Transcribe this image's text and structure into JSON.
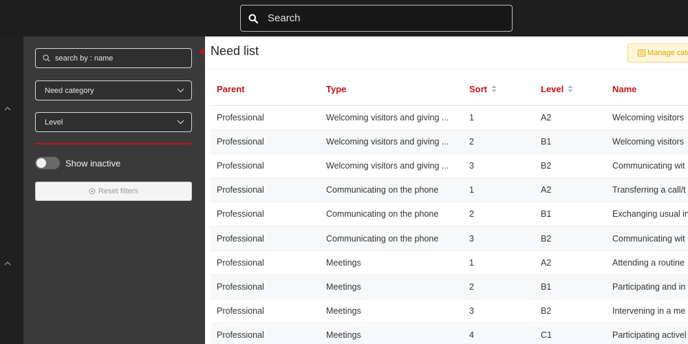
{
  "global_search": {
    "placeholder": "Search"
  },
  "filters": {
    "search_placeholder": "search by : name",
    "need_category": "Need category",
    "level": "Level",
    "show_inactive": "Show inactive",
    "reset_label": "Reset filters"
  },
  "main": {
    "title": "Need list",
    "manage_label": "Manage cate"
  },
  "table": {
    "headers": {
      "parent": "Parent",
      "type": "Type",
      "sort": "Sort",
      "level": "Level",
      "name": "Name"
    },
    "rows": [
      {
        "parent": "Professional",
        "type": "Welcoming visitors and giving ...",
        "sort": "1",
        "level": "A2",
        "name": "Welcoming visitors"
      },
      {
        "parent": "Professional",
        "type": "Welcoming visitors and giving ...",
        "sort": "2",
        "level": "B1",
        "name": "Welcoming visitors"
      },
      {
        "parent": "Professional",
        "type": "Welcoming visitors and giving ...",
        "sort": "3",
        "level": "B2",
        "name": "Communicating wit"
      },
      {
        "parent": "Professional",
        "type": "Communicating on the phone",
        "sort": "1",
        "level": "A2",
        "name": "Transferring a call/t"
      },
      {
        "parent": "Professional",
        "type": "Communicating on the phone",
        "sort": "2",
        "level": "B1",
        "name": "Exchanging usual in"
      },
      {
        "parent": "Professional",
        "type": "Communicating on the phone",
        "sort": "3",
        "level": "B2",
        "name": "Communicating wit"
      },
      {
        "parent": "Professional",
        "type": "Meetings",
        "sort": "1",
        "level": "A2",
        "name": "Attending a routine"
      },
      {
        "parent": "Professional",
        "type": "Meetings",
        "sort": "2",
        "level": "B1",
        "name": "Participating and in"
      },
      {
        "parent": "Professional",
        "type": "Meetings",
        "sort": "3",
        "level": "B2",
        "name": "Intervening in a me"
      },
      {
        "parent": "Professional",
        "type": "Meetings",
        "sort": "4",
        "level": "C1",
        "name": "Participating activel"
      }
    ]
  },
  "colors": {
    "accent": "#c0141b",
    "manage_bg": "#fff6d9",
    "manage_text": "#e0a400"
  }
}
